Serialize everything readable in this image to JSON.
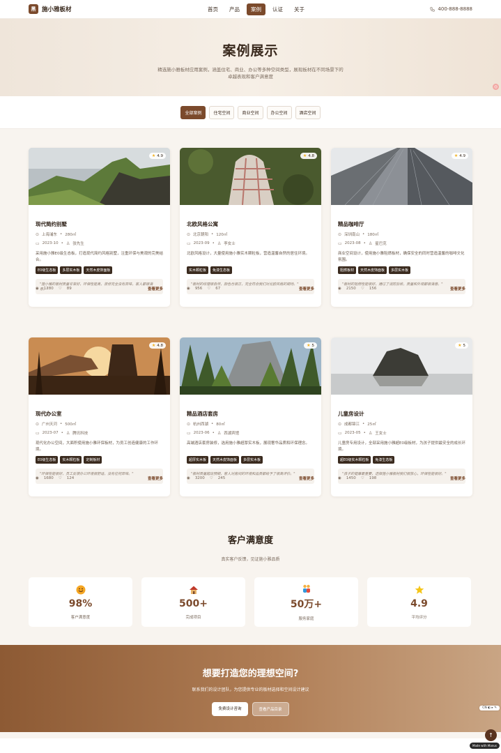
{
  "brand": {
    "mark": "黑",
    "name": "施小雅板材"
  },
  "nav": [
    {
      "label": "首页"
    },
    {
      "label": "产品"
    },
    {
      "label": "案例"
    },
    {
      "label": "认证"
    },
    {
      "label": "关于"
    }
  ],
  "nav_active": 2,
  "phone": "400-888-8888",
  "hero": {
    "title": "案例展示",
    "subtitle_line1": "精选施小雅板材应用案例，涵盖住宅、商业、办公等多种空间类型，展现板材在不同场景下的",
    "subtitle_line2": "卓越表现和客户满意度"
  },
  "filters": [
    {
      "label": "全部案例"
    },
    {
      "label": "住宅空间"
    },
    {
      "label": "商业空间"
    },
    {
      "label": "办公空间"
    },
    {
      "label": "酒店空间"
    }
  ],
  "filter_active": 0,
  "cases": [
    {
      "title": "现代简约别墅",
      "location": "上海浦东",
      "area": "280㎡",
      "date": "2023-10",
      "client": "张先生",
      "rating": "4.9",
      "desc": "采用施小雅E0级生态板，打造现代简约风格别墅，注重环保与美观的完美结合。",
      "tags": [
        "E0级生态板",
        "多层实木板",
        "天然木皮饰面板"
      ],
      "quote": "\"施小雅的板材质量非常好，环保性能高，装修完全没有异味，家人都很满意。\"",
      "views": "1280",
      "likes": "89",
      "more": "查看更多",
      "img": "mountain"
    },
    {
      "title": "北欧风格公寓",
      "location": "北京朝阳",
      "area": "120㎡",
      "date": "2023-09",
      "client": "李女士",
      "rating": "4.8",
      "desc": "北欧风格设计，大量使用施小雅实木颗粒板，营造温馨自然的居住环境。",
      "tags": [
        "实木颗粒板",
        "免漆生态板"
      ],
      "quote": "\"板材的纹理很自然，颜色也很正，完全符合我们对北欧风格的期待。\"",
      "views": "956",
      "likes": "67",
      "more": "查看更多",
      "img": "blanket"
    },
    {
      "title": "精品咖啡厅",
      "location": "深圳南山",
      "area": "180㎡",
      "date": "2023-08",
      "client": "星巴克",
      "rating": "4.9",
      "desc": "商业空间设计，使用施小雅阻燃板材，确保安全的同时营造温馨的咖啡文化氛围。",
      "tags": [
        "阻燃板材",
        "天然木皮饰面板",
        "多层实木板"
      ],
      "quote": "\"板材的阻燃性能很好，通过了消防验收，质量和外观都很满意。\"",
      "views": "2150",
      "likes": "156",
      "more": "查看更多",
      "img": "building"
    },
    {
      "title": "现代办公室",
      "location": "广州天河",
      "area": "500㎡",
      "date": "2023-07",
      "client": "腾讯科技",
      "rating": "4.8",
      "desc": "现代化办公空间，大面积使用施小雅环保板材，为员工创造健康的工作环境。",
      "tags": [
        "E0级生态板",
        "实木颗粒板",
        "定制板材"
      ],
      "quote": "\"环保性能很好，员工反馈办公环境很舒适，没有任何异味。\"",
      "views": "1680",
      "likes": "124",
      "more": "查看更多",
      "img": "sunset"
    },
    {
      "title": "精品酒店套房",
      "location": "杭州西湖",
      "area": "80㎡",
      "date": "2023-06",
      "client": "西湖宾馆",
      "rating": "5",
      "desc": "高端酒店套房装修，选用施小雅超厚实木板，展现奢华品质和环保理念。",
      "tags": [
        "超厚实木板",
        "天然木皮饰面板",
        "多层实木板"
      ],
      "quote": "\"板材质量超出预期，客人对房间的环境和品质都给予了很高评价。\"",
      "views": "3200",
      "likes": "245",
      "more": "查看更多",
      "img": "forest"
    },
    {
      "title": "儿童房设计",
      "location": "成都锦江",
      "area": "25㎡",
      "date": "2023-05",
      "client": "王女士",
      "rating": "5",
      "desc": "儿童房专用设计，全部采用施小雅超E0级板材，为孩子提供最安全的成长环境。",
      "tags": [
        "超E0级实木颗粒板",
        "免漆生态板"
      ],
      "quote": "\"孩子的健康最重要，选择施小雅板材我们很放心，环保性能很好。\"",
      "views": "1450",
      "likes": "198",
      "more": "查看更多",
      "img": "rock"
    }
  ],
  "satisfaction": {
    "title": "客户满意度",
    "subtitle": "真实客户反馈，见证施小雅品质",
    "stats": [
      {
        "num": "98%",
        "label": "客户满意度",
        "icon": "smile-emoji"
      },
      {
        "num": "500+",
        "label": "完成项目",
        "icon": "house-emoji"
      },
      {
        "num": "50万+",
        "label": "服务家庭",
        "icon": "family-emoji"
      },
      {
        "num": "4.9",
        "label": "平均评分",
        "icon": "star-emoji"
      }
    ]
  },
  "cta": {
    "title": "想要打造您的理想空间?",
    "subtitle": "联系我们的设计团队，为您提供专业的板材选择和空间设计建议",
    "btn1": "免费设计咨询",
    "btn2": "查看产品目录"
  },
  "widgets": {
    "lang": "CN  ◐  ▸  ✎",
    "totop": "↑",
    "made": "Made with Manus"
  },
  "colors": {
    "brand": "#7b4a2c",
    "bg": "#f8f4ef"
  }
}
